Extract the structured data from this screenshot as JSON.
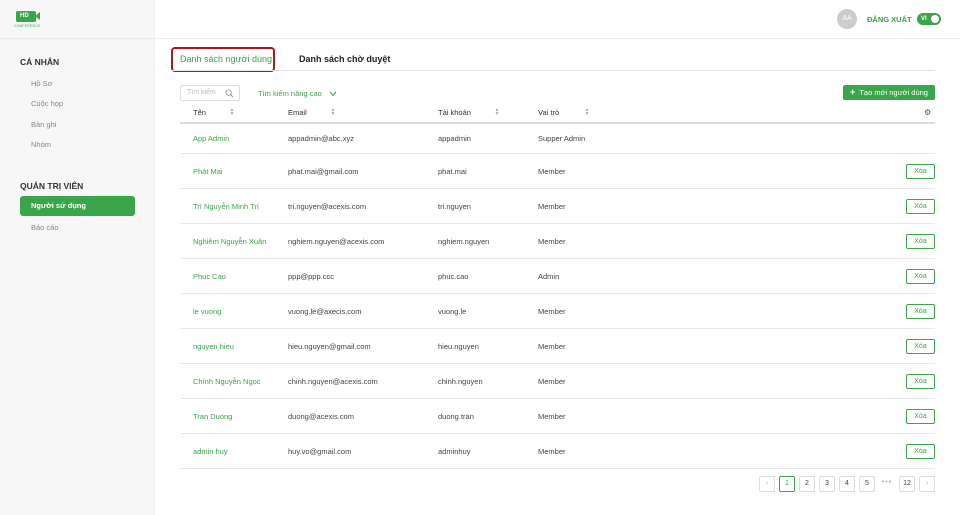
{
  "logo": {
    "badge": "HD",
    "text": "CONFERENCE"
  },
  "sidebar": {
    "section_personal": "CÁ NHÂN",
    "personal_items": [
      {
        "label": "Hồ Sơ"
      },
      {
        "label": "Cuộc họp"
      },
      {
        "label": "Bản ghi"
      },
      {
        "label": "Nhóm"
      }
    ],
    "section_admin": "QUẢN TRỊ VIÊN",
    "admin_items": [
      {
        "label": "Người sử dụng",
        "active": true
      },
      {
        "label": "Báo cáo"
      }
    ]
  },
  "header": {
    "avatar_initials": "AA",
    "logout_label": "ĐĂNG XUẤT",
    "language_toggle": "VI"
  },
  "tabs": [
    {
      "label": "Danh sách người dùng",
      "active": true
    },
    {
      "label": "Danh sách chờ duyệt",
      "active": false
    }
  ],
  "toolbar": {
    "search_placeholder": "Tìm kiếm",
    "advanced_search_label": "Tìm kiếm nâng cao",
    "create_button_label": "Tạo mới người dùng"
  },
  "table": {
    "columns": [
      "Tên",
      "Email",
      "Tài khoản",
      "Vai trò"
    ],
    "delete_label": "Xóa",
    "rows": [
      {
        "name": "App Admin",
        "email": "appadmin@abc.xyz",
        "account": "appadmin",
        "role": "Supper Admin",
        "deletable": false
      },
      {
        "name": "Phát Mai",
        "email": "phat.mai@gmail.com",
        "account": "phat.mai",
        "role": "Member",
        "deletable": true
      },
      {
        "name": "Trí Nguyễn Minh Trí",
        "email": "tri.nguyen@acexis.com",
        "account": "tri.nguyen",
        "role": "Member",
        "deletable": true
      },
      {
        "name": "Nghiêm Nguyễn Xuân",
        "email": "nghiem.nguyen@acexis.com",
        "account": "nghiem.nguyen",
        "role": "Member",
        "deletable": true
      },
      {
        "name": "Phuc Cao",
        "email": "ppp@ppp.ccc",
        "account": "phuc.cao",
        "role": "Admin",
        "deletable": true
      },
      {
        "name": "le vuong",
        "email": "vuong.le@axecis.com",
        "account": "vuong.le",
        "role": "Member",
        "deletable": true
      },
      {
        "name": "nguyen hieu",
        "email": "hieu.nguyen@gmail.com",
        "account": "hieu.nguyen",
        "role": "Member",
        "deletable": true
      },
      {
        "name": "Chính Nguyễn Ngọc",
        "email": "chinh.nguyen@acexis.com",
        "account": "chinh.nguyen",
        "role": "Member",
        "deletable": true
      },
      {
        "name": "Tran Duong",
        "email": "duong@acexis.com",
        "account": "duong.tran",
        "role": "Member",
        "deletable": true
      },
      {
        "name": "admin huy",
        "email": "huy.vo@gmail.com",
        "account": "adminhuy",
        "role": "Member",
        "deletable": true
      }
    ]
  },
  "pagination": {
    "prev": "‹",
    "next": "›",
    "pages": [
      "1",
      "2",
      "3",
      "4",
      "5"
    ],
    "ellipsis": "•••",
    "last": "12",
    "current": "1"
  },
  "colors": {
    "accent": "#3aa54a",
    "highlight": "#b01820"
  }
}
